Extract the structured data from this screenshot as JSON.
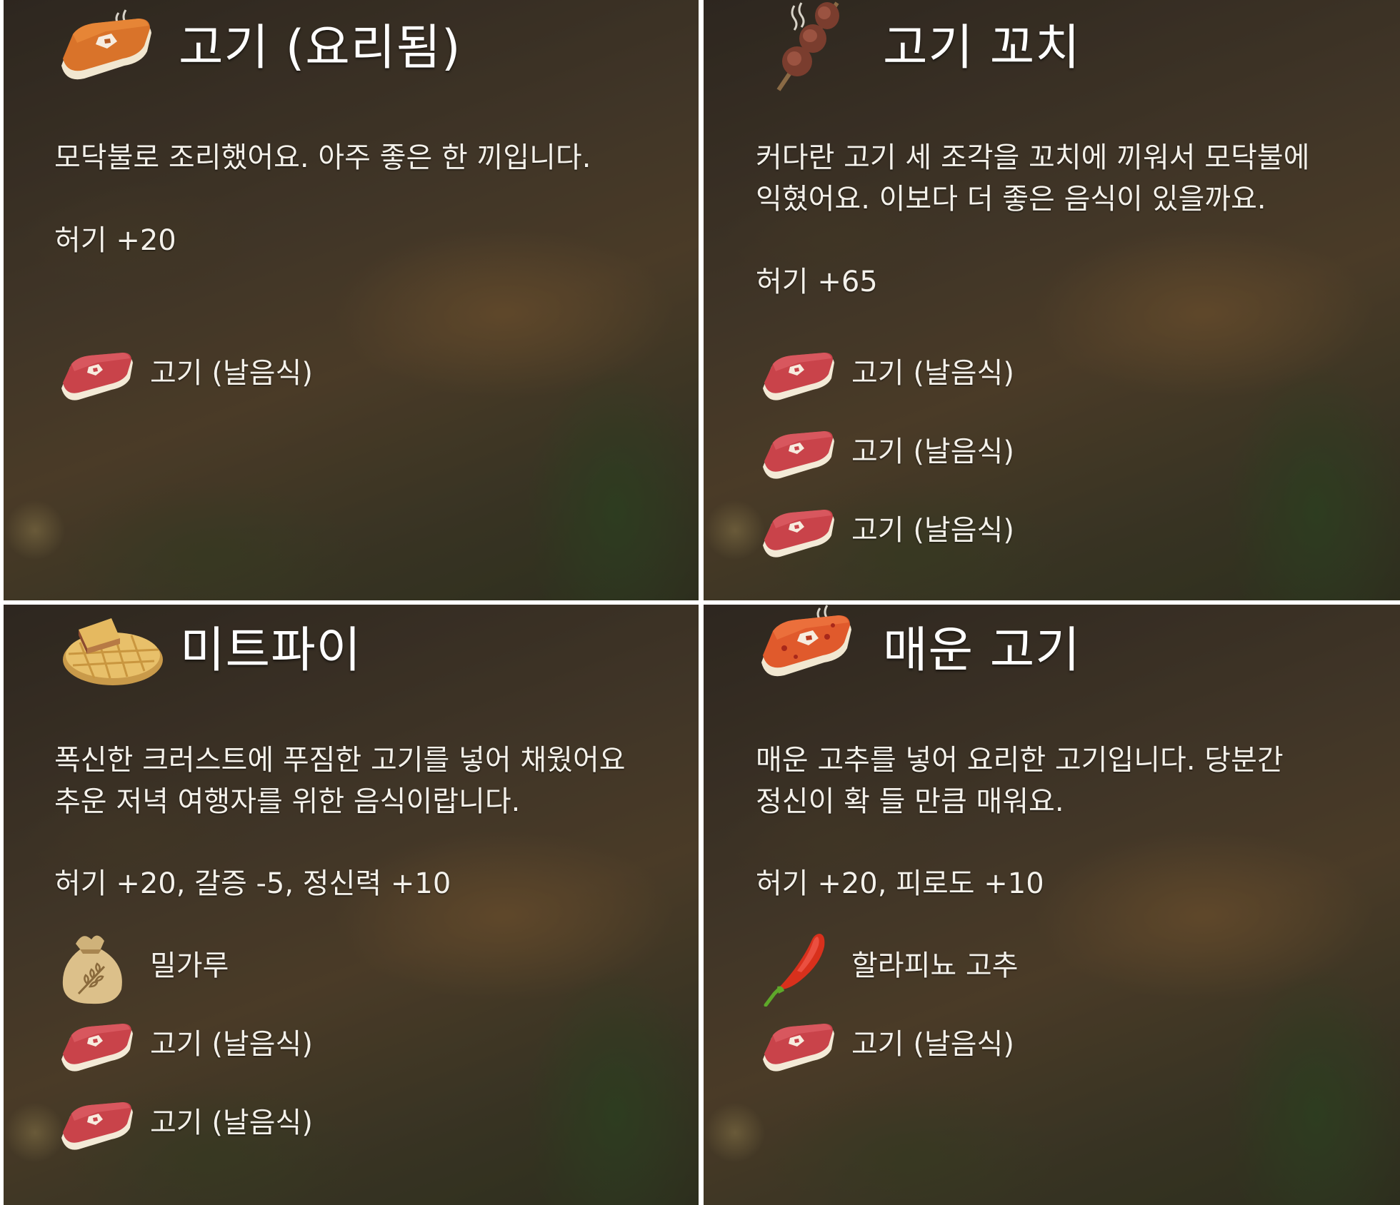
{
  "panels": [
    {
      "title": "고기 (요리됨)",
      "title_icon": "cooked-meat-icon",
      "description": "모닥불로 조리했어요. 아주 좋은 한 끼입니다.",
      "stats": "허기 +20",
      "ingredients": [
        {
          "label": "고기 (날음식)",
          "icon": "raw-meat-icon"
        }
      ]
    },
    {
      "title": "고기 꼬치",
      "title_icon": "meat-skewer-icon",
      "description": "커다란 고기 세 조각을 꼬치에 끼워서 모닥불에\n익혔어요. 이보다 더 좋은 음식이 있을까요.",
      "stats": "허기 +65",
      "ingredients": [
        {
          "label": "고기 (날음식)",
          "icon": "raw-meat-icon"
        },
        {
          "label": "고기 (날음식)",
          "icon": "raw-meat-icon"
        },
        {
          "label": "고기 (날음식)",
          "icon": "raw-meat-icon"
        }
      ]
    },
    {
      "title": "미트파이",
      "title_icon": "meat-pie-icon",
      "description": "폭신한 크러스트에 푸짐한 고기를 넣어 채웠어요\n추운 저녁 여행자를 위한 음식이랍니다.",
      "stats": "허기 +20, 갈증 -5, 정신력 +10",
      "ingredients": [
        {
          "label": "밀가루",
          "icon": "flour-sack-icon"
        },
        {
          "label": "고기 (날음식)",
          "icon": "raw-meat-icon"
        },
        {
          "label": "고기 (날음식)",
          "icon": "raw-meat-icon"
        }
      ]
    },
    {
      "title": "매운 고기",
      "title_icon": "spicy-meat-icon",
      "description": "매운 고추를 넣어 요리한 고기입니다. 당분간\n정신이 확 들 만큼 매워요.",
      "stats": "허기 +20, 피로도 +10",
      "ingredients": [
        {
          "label": "할라피뇨 고추",
          "icon": "jalapeno-pepper-icon"
        },
        {
          "label": "고기 (날음식)",
          "icon": "raw-meat-icon"
        }
      ]
    }
  ]
}
